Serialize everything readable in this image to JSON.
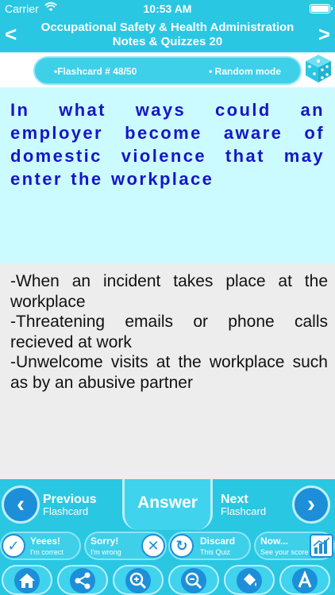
{
  "status": {
    "carrier": "Carrier",
    "time": "10:53 AM"
  },
  "header": {
    "title_line1": "Occupational Safety & Health Administration",
    "title_line2": "Notes & Quizzes 20",
    "prev_glyph": "<",
    "next_glyph": ">"
  },
  "info": {
    "flashcard": "•Flashcard #  48/50",
    "mode": "• Random mode"
  },
  "question": "In what ways could an employer become aware of domestic violence that may enter the workplace",
  "answer_lines": [
    "-When an incident takes place at the workplace",
    "-Threatening emails or phone calls recieved at work",
    "-Unwelcome visits at the workplace such as by an abusive partner"
  ],
  "nav": {
    "previous": {
      "title": "Previous",
      "sub": "Flashcard"
    },
    "answer": "Answer",
    "next": {
      "title": "Next",
      "sub": "Flashcard"
    }
  },
  "actions": {
    "yes": {
      "title": "Yeees!",
      "sub": "I'm correct"
    },
    "sorry": {
      "title": "Sorry!",
      "sub": "I'm wrong"
    },
    "discard": {
      "title": "Discard",
      "sub": "This Quiz"
    },
    "now": {
      "title": "Now...",
      "sub": "See your score"
    }
  },
  "toolbar_icons": [
    "home-icon",
    "share-icon",
    "zoom-in-icon",
    "zoom-out-icon",
    "paint-bucket-icon",
    "font-icon"
  ],
  "colors": {
    "bar": "#2ac7e3",
    "question_bg": "#ccfbff",
    "question_text": "#1416c8",
    "answer_bg": "#ededed",
    "icon_blue": "#1d8fd8"
  }
}
